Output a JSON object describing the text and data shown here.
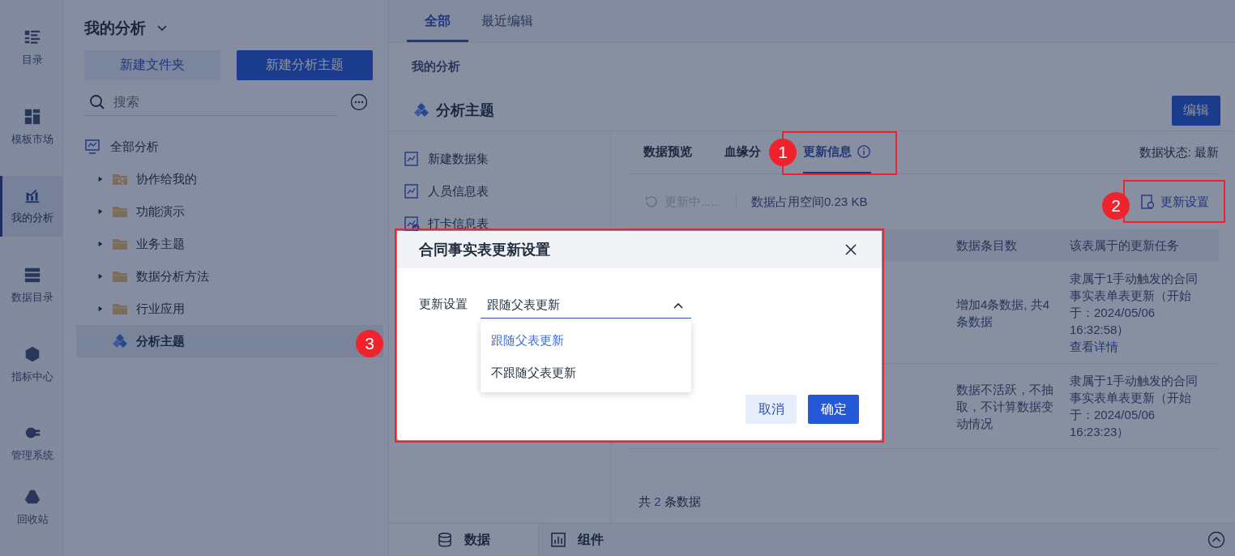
{
  "rail": [
    {
      "label": "目录",
      "kind": "catalog",
      "selected": false
    },
    {
      "label": "模板市场",
      "kind": "template",
      "selected": false
    },
    {
      "label": "我的分析",
      "kind": "analysis",
      "selected": true
    },
    {
      "label": "数据目录",
      "kind": "data",
      "selected": false
    },
    {
      "label": "指标中心",
      "kind": "metric",
      "selected": false
    },
    {
      "label": "管理系统",
      "kind": "admin",
      "selected": false
    },
    {
      "label": "回收站",
      "kind": "trash",
      "selected": false
    }
  ],
  "sidebar": {
    "title": "我的分析",
    "buttons": [
      {
        "label": "新建文件夹",
        "kind": "secondary"
      },
      {
        "label": "新建分析主题",
        "kind": "primary"
      }
    ],
    "search": {
      "placeholder": "搜索"
    },
    "tree": [
      {
        "label": "全部分析",
        "kind": "root",
        "selected": false,
        "children": [
          {
            "label": "协作给我的",
            "kind": "shared-folder",
            "selected": false,
            "expanded": false
          },
          {
            "label": "功能演示",
            "kind": "folder",
            "selected": false,
            "expanded": false
          },
          {
            "label": "业务主题",
            "kind": "folder",
            "selected": false,
            "expanded": false
          },
          {
            "label": "数据分析方法",
            "kind": "folder",
            "selected": false,
            "expanded": false
          },
          {
            "label": "行业应用",
            "kind": "folder",
            "selected": false,
            "expanded": false
          },
          {
            "label": "分析主题",
            "kind": "topic",
            "selected": true
          }
        ]
      }
    ]
  },
  "tabs": [
    {
      "label": "全部",
      "selected": true
    },
    {
      "label": "最近编辑",
      "selected": false
    }
  ],
  "breadcrumb": "我的分析",
  "topic": {
    "title": "分析主题",
    "edit_button": "编辑"
  },
  "datasets": [
    {
      "label": "新建数据集",
      "kind": "dataset"
    },
    {
      "label": "人员信息表",
      "kind": "dataset"
    },
    {
      "label": "打卡信息表",
      "kind": "checked-dataset"
    }
  ],
  "detail_tabs": [
    {
      "label": "数据预览",
      "selected": false
    },
    {
      "label": "血缘分",
      "selected": false
    },
    {
      "label": "更新信息",
      "selected": true
    }
  ],
  "data_status": "数据状态: 最新",
  "update_status": {
    "label": "更新中......",
    "disabled": true
  },
  "storage": "数据占用空间0.23 KB",
  "settings_button": "更新设置",
  "table": {
    "columns": [
      "数据条目数",
      "该表属于的更新任务"
    ],
    "rows": [
      {
        "cells": [
          "增加4条数据, 共4条数据",
          "隶属于1手动触发的合同事实表单表更新（开始于：2024/05/06 16:32:58）"
        ],
        "link": "查看详情"
      },
      {
        "cells": [
          "数据不活跃，不抽取，不计算数据变动情况",
          "隶属于1手动触发的合同事实表单表更新（开始于：2024/05/06 16:23:23）"
        ]
      }
    ]
  },
  "total": {
    "prefix": "共",
    "count": "2",
    "suffix": "条数据"
  },
  "bottom_tabs": [
    {
      "label": "数据",
      "kind": "data",
      "selected": true
    },
    {
      "label": "组件",
      "kind": "widget",
      "selected": false
    }
  ],
  "dialog": {
    "title": "合同事实表更新设置",
    "field_label": "更新设置",
    "value": "跟随父表更新",
    "options": [
      {
        "label": "跟随父表更新",
        "selected": true
      },
      {
        "label": "不跟随父表更新",
        "selected": false
      }
    ],
    "buttons": [
      {
        "label": "取消",
        "kind": "secondary"
      },
      {
        "label": "确定",
        "kind": "primary"
      }
    ]
  },
  "annotations": [
    "1",
    "2",
    "3"
  ]
}
